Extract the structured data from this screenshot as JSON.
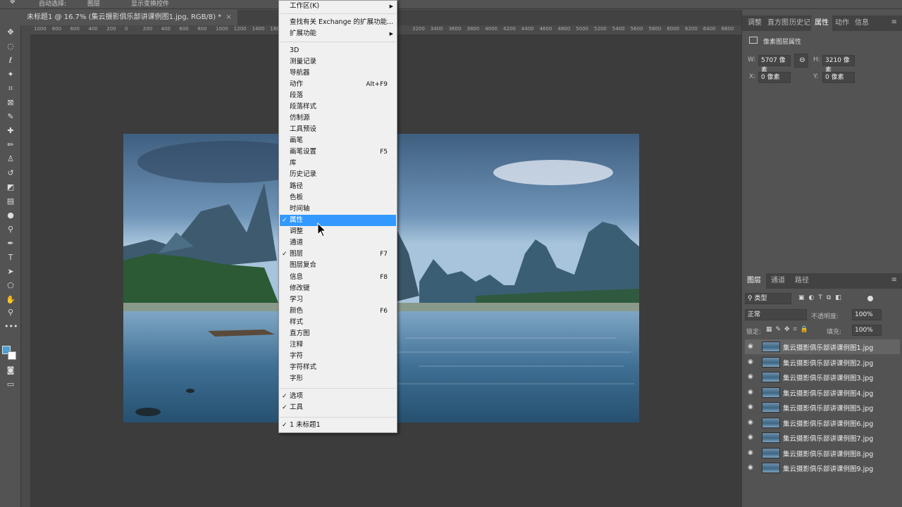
{
  "options_bar": {
    "auto_select_label": "自动选择:",
    "auto_select_target": "图层",
    "show_transform_label": "显示变换控件"
  },
  "document": {
    "tab_title": "未标题1 @ 16.7% (集云摄影俱乐部讲课例图1.jpg, RGB/8) *",
    "close": "×"
  },
  "ruler_ticks": [
    "1000",
    "800",
    "600",
    "400",
    "200",
    "0",
    "200",
    "400",
    "600",
    "800",
    "1000",
    "1200",
    "1400",
    "160",
    "3200",
    "3400",
    "3600",
    "3800",
    "4000",
    "4200",
    "4400",
    "4600",
    "4800",
    "5000",
    "5200",
    "5400",
    "5600",
    "5800",
    "6000",
    "6200",
    "6400",
    "6600"
  ],
  "window_menu": {
    "items": [
      {
        "label": "工作区(K)",
        "check": "",
        "shortcut": "",
        "submenu": true
      },
      {
        "label": "查找有关 Exchange 的扩展功能...",
        "check": "",
        "shortcut": "",
        "submenu": false
      },
      {
        "label": "扩展功能",
        "check": "",
        "shortcut": "",
        "submenu": true
      },
      {
        "label": "3D",
        "check": "",
        "shortcut": ""
      },
      {
        "label": "测量记录",
        "check": "",
        "shortcut": ""
      },
      {
        "label": "导航器",
        "check": "",
        "shortcut": ""
      },
      {
        "label": "动作",
        "check": "",
        "shortcut": "Alt+F9"
      },
      {
        "label": "段落",
        "check": "",
        "shortcut": ""
      },
      {
        "label": "段落样式",
        "check": "",
        "shortcut": ""
      },
      {
        "label": "仿制源",
        "check": "",
        "shortcut": ""
      },
      {
        "label": "工具预设",
        "check": "",
        "shortcut": ""
      },
      {
        "label": "画笔",
        "check": "",
        "shortcut": ""
      },
      {
        "label": "画笔设置",
        "check": "",
        "shortcut": "F5"
      },
      {
        "label": "库",
        "check": "",
        "shortcut": ""
      },
      {
        "label": "历史记录",
        "check": "",
        "shortcut": ""
      },
      {
        "label": "路径",
        "check": "",
        "shortcut": ""
      },
      {
        "label": "色板",
        "check": "",
        "shortcut": ""
      },
      {
        "label": "时间轴",
        "check": "",
        "shortcut": ""
      },
      {
        "label": "属性",
        "check": "✓",
        "shortcut": ""
      },
      {
        "label": "调整",
        "check": "",
        "shortcut": ""
      },
      {
        "label": "通道",
        "check": "",
        "shortcut": ""
      },
      {
        "label": "图层",
        "check": "✓",
        "shortcut": "F7"
      },
      {
        "label": "图层复合",
        "check": "",
        "shortcut": ""
      },
      {
        "label": "信息",
        "check": "",
        "shortcut": "F8"
      },
      {
        "label": "修改键",
        "check": "",
        "shortcut": ""
      },
      {
        "label": "学习",
        "check": "",
        "shortcut": ""
      },
      {
        "label": "颜色",
        "check": "",
        "shortcut": "F6"
      },
      {
        "label": "样式",
        "check": "",
        "shortcut": ""
      },
      {
        "label": "直方图",
        "check": "",
        "shortcut": ""
      },
      {
        "label": "注释",
        "check": "",
        "shortcut": ""
      },
      {
        "label": "字符",
        "check": "",
        "shortcut": ""
      },
      {
        "label": "字符样式",
        "check": "",
        "shortcut": ""
      },
      {
        "label": "字形",
        "check": "",
        "shortcut": ""
      },
      {
        "label": "选项",
        "check": "✓",
        "shortcut": ""
      },
      {
        "label": "工具",
        "check": "✓",
        "shortcut": ""
      },
      {
        "label": "1 未标题1",
        "check": "✓",
        "shortcut": ""
      }
    ]
  },
  "top_panel": {
    "tabs": [
      "调整",
      "直方图",
      "历史记",
      "属性",
      "动作",
      "信息"
    ],
    "active_tab": "属性",
    "title": "像素图层属性",
    "w_label": "W:",
    "w_value": "5707 像素",
    "h_label": "H:",
    "h_value": "3210 像素",
    "x_label": "X:",
    "x_value": "0 像素",
    "y_label": "Y:",
    "y_value": "0 像素"
  },
  "layers_panel": {
    "tabs": [
      "图层",
      "通道",
      "路径"
    ],
    "active_tab": "图层",
    "filter_label": "类型",
    "blend_mode": "正常",
    "opacity_label": "不透明度:",
    "opacity_value": "100%",
    "lock_label": "锁定:",
    "fill_label": "填充:",
    "fill_value": "100%",
    "layers": [
      "集云摄影俱乐部讲课例图1.jpg",
      "集云摄影俱乐部讲课例图2.jpg",
      "集云摄影俱乐部讲课例图3.jpg",
      "集云摄影俱乐部讲课例图4.jpg",
      "集云摄影俱乐部讲课例图5.jpg",
      "集云摄影俱乐部讲课例图6.jpg",
      "集云摄影俱乐部讲课例图7.jpg",
      "集云摄影俱乐部讲课例图8.jpg",
      "集云摄影俱乐部讲课例图9.jpg"
    ]
  },
  "colors": {
    "menu_highlight": "#3399ff",
    "foreground": "#4aa0d0",
    "background": "#ffffff"
  }
}
